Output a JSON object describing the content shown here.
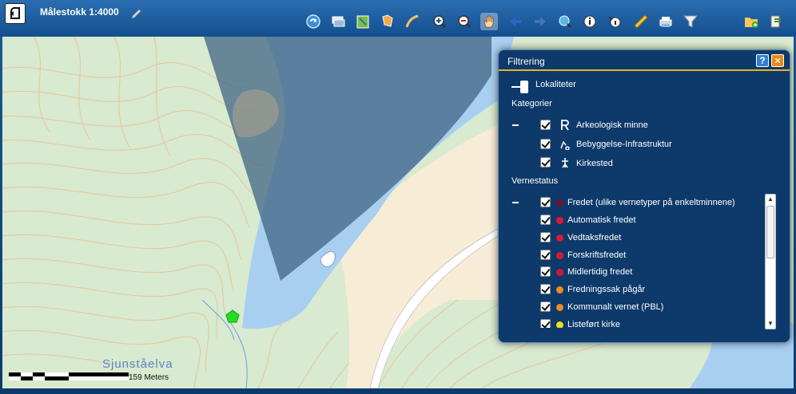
{
  "toolbar": {
    "scale_label": "Målestokk 1:4000",
    "tools": [
      "refresh-icon",
      "layers-icon",
      "map-icon",
      "select-area-icon",
      "draw-line-icon",
      "zoom-in-icon",
      "zoom-out-icon",
      "pan-hand-icon",
      "back-arrow-icon",
      "forward-arrow-icon",
      "globe-search-icon",
      "info-icon",
      "point-info-icon",
      "measure-ruler-icon",
      "print-icon",
      "filter-funnel-icon",
      "add-folder-icon",
      "export-icon"
    ],
    "active_tool": "pan-hand-icon"
  },
  "map": {
    "place_label": "Sjunståelva",
    "scale_label": "159 Meters"
  },
  "filter": {
    "title": "Filtrering",
    "help_label": "?",
    "close_label": "×",
    "localities_label": "Lokaliteter",
    "categories_heading": "Kategorier",
    "categories": [
      {
        "label": "Arkeologisk minne",
        "icon": "archaeology-icon"
      },
      {
        "label": "Bebyggelse-Infrastruktur",
        "icon": "building-icon"
      },
      {
        "label": "Kirkested",
        "icon": "church-site-icon"
      }
    ],
    "status_heading": "Vernestatus",
    "statuses": [
      {
        "label": "Fredet (ulike vernetyper på enkeltminnene)",
        "color": "#7a0f2c"
      },
      {
        "label": "Automatisk fredet",
        "color": "#e0182f"
      },
      {
        "label": "Vedtaksfredet",
        "color": "#e0182f"
      },
      {
        "label": "Forskriftsfredet",
        "color": "#e0182f"
      },
      {
        "label": "Midlertidig fredet",
        "color": "#d91238"
      },
      {
        "label": "Fredningssak pågår",
        "color": "#ef8a25"
      },
      {
        "label": "Kommunalt vernet (PBL)",
        "color": "#ef8a25"
      },
      {
        "label": "Listeført kirke",
        "color": "#f2de18"
      }
    ]
  }
}
